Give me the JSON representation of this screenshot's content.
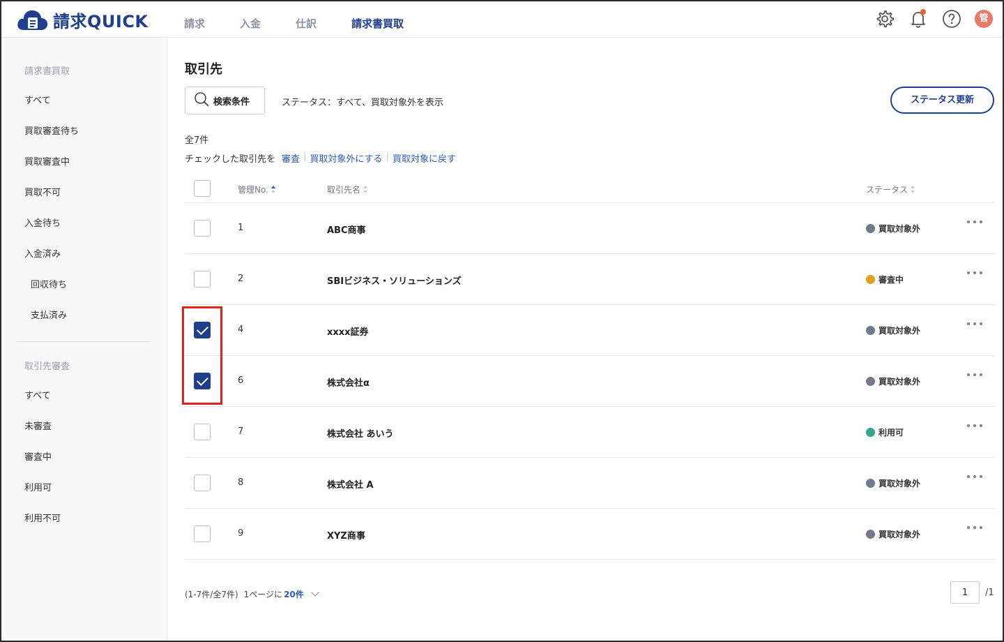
{
  "app": {
    "logo_text": "請求QUICK"
  },
  "nav": {
    "items": [
      {
        "label": "請求",
        "active": false
      },
      {
        "label": "入金",
        "active": false
      },
      {
        "label": "仕訳",
        "active": false
      },
      {
        "label": "請求書買取",
        "active": true
      }
    ]
  },
  "header_icons": [
    "gear-icon",
    "bell-icon",
    "help-icon"
  ],
  "user": {
    "avatar_label": "管"
  },
  "sidebar": {
    "section1": {
      "title": "請求書買取",
      "items": [
        "すべて",
        "買取審査待ち",
        "買取審査中",
        "買取不可",
        "入金待ち",
        "入金済み",
        "回収待ち",
        "支払済み"
      ]
    },
    "section2": {
      "title": "取引先審査",
      "items": [
        "すべて",
        "未審査",
        "審査中",
        "利用可",
        "利用不可"
      ]
    }
  },
  "main": {
    "title": "取引先",
    "search_button": "検索条件",
    "status_filter": "ステータス：すべて、買取対象外を表示",
    "status_update_button": "ステータス更新",
    "total": "全7件",
    "bulk_prefix": "チェックした取引先を",
    "bulk_actions": [
      "審査",
      "買取対象外にする",
      "買取対象に戻す"
    ],
    "columns": {
      "no": "管理No.",
      "name": "取引先名",
      "status": "ステータス"
    },
    "rows": [
      {
        "no": "1",
        "name": "ABC商事",
        "status": "買取対象外",
        "status_color": "#6f7a8a",
        "checked": false
      },
      {
        "no": "2",
        "name": "SBIビジネス・ソリューションズ",
        "status": "審査中",
        "status_color": "#e0a21c",
        "checked": false
      },
      {
        "no": "4",
        "name": "xxxx証券",
        "status": "買取対象外",
        "status_color": "#6f7a8a",
        "checked": true
      },
      {
        "no": "6",
        "name": "株式会社α",
        "status": "買取対象外",
        "status_color": "#6f7a8a",
        "checked": true
      },
      {
        "no": "7",
        "name": "株式会社 あいう",
        "status": "利用可",
        "status_color": "#3aa58e",
        "checked": false
      },
      {
        "no": "8",
        "name": "株式会社 A",
        "status": "買取対象外",
        "status_color": "#6f7a8a",
        "checked": false
      },
      {
        "no": "9",
        "name": "XYZ商事",
        "status": "買取対象外",
        "status_color": "#6f7a8a",
        "checked": false
      }
    ]
  },
  "pager": {
    "range": "(1-7件/全7件)",
    "per_page_prefix": "1ページに",
    "per_page": "20件",
    "current_page": "1",
    "total_pages": "/1"
  },
  "colors": {
    "brand": "#1f3f8c",
    "link": "#2e5bb8",
    "highlight": "#e0231e"
  }
}
